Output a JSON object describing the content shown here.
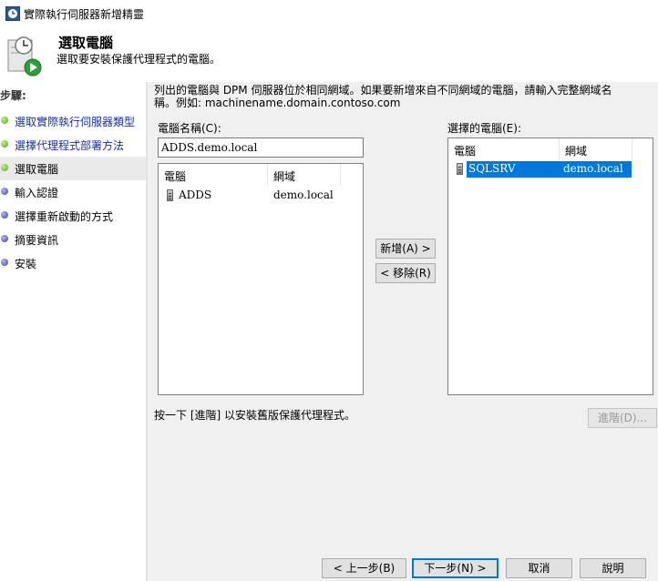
{
  "window": {
    "title": "實際執行伺服器新增精靈"
  },
  "header": {
    "title": "選取電腦",
    "subtitle": "選取要安裝保護代理程式的電腦。"
  },
  "steps": {
    "title": "步驟:",
    "items": [
      {
        "label": "選取實際執行伺服器類型",
        "state": "done"
      },
      {
        "label": "選擇代理程式部署方法",
        "state": "done"
      },
      {
        "label": "選取電腦",
        "state": "current"
      },
      {
        "label": "輸入認證",
        "state": "pending"
      },
      {
        "label": "選擇重新啟動的方式",
        "state": "pending"
      },
      {
        "label": "摘要資訊",
        "state": "pending"
      },
      {
        "label": "安裝",
        "state": "pending"
      }
    ]
  },
  "main": {
    "description": "列出的電腦與 DPM 伺服器位於相同網域。如果要新增來自不同網域的電腦，請輸入完整網域名稱。例如: machinename.domain.contoso.com",
    "computer_name_label": "電腦名稱(C):",
    "computer_name_value": "ADDS.demo.local",
    "available": {
      "columns": [
        "電腦",
        "網域"
      ],
      "rows": [
        {
          "computer": "ADDS",
          "domain": "demo.local"
        }
      ]
    },
    "selected_label": "選擇的電腦(E):",
    "selected": {
      "columns": [
        "電腦",
        "網域"
      ],
      "rows": [
        {
          "computer": "SQLSRV",
          "domain": "demo.local"
        }
      ]
    },
    "add_button": "新增(A) >",
    "remove_button": "< 移除(R)",
    "hint": "按一下 [進階] 以安裝舊版保護代理程式。",
    "advanced_button": "進階(D)..."
  },
  "footer": {
    "back": "< 上一步(B)",
    "next": "下一步(N) >",
    "cancel": "取消",
    "help": "說明"
  },
  "colors": {
    "selection": "#0078d7",
    "link": "#1a2fa6",
    "step_done": "#4aa80e",
    "step_pending": "#3b3ba8"
  }
}
